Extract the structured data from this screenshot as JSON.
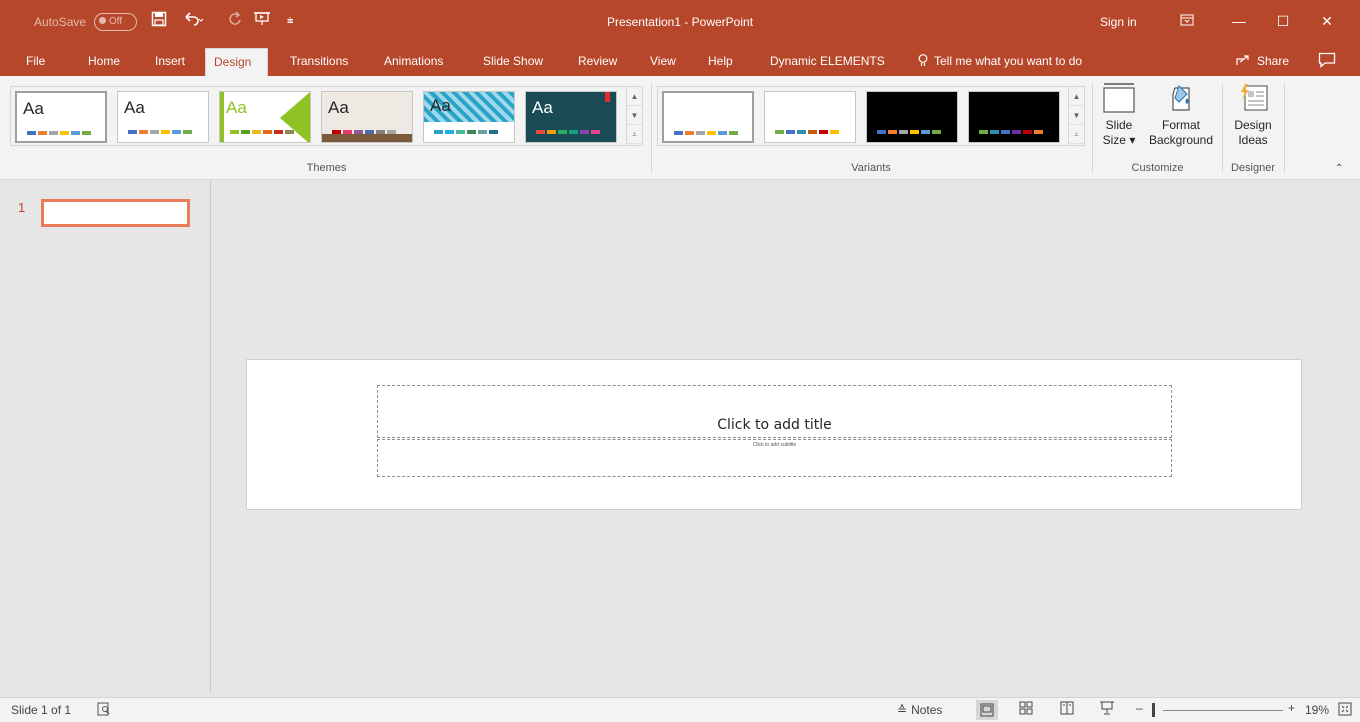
{
  "titlebar": {
    "autosave_label": "AutoSave",
    "autosave_state": "Off",
    "window_title": "Presentation1  -  PowerPoint",
    "sign_in": "Sign in"
  },
  "tabs": [
    "File",
    "Home",
    "Insert",
    "Design",
    "Transitions",
    "Animations",
    "Slide Show",
    "Review",
    "View",
    "Help",
    "Dynamic ELEMENTS"
  ],
  "active_tab": "Design",
  "tell_me": "Tell me what you want to do",
  "share": "Share",
  "ribbon": {
    "themes_label": "Themes",
    "variants_label": "Variants",
    "customize_label": "Customize",
    "designer_label": "Designer",
    "theme_sample": "Aa",
    "slide_size_line1": "Slide",
    "slide_size_line2": "Size ▾",
    "format_bg_line1": "Format",
    "format_bg_line2": "Background",
    "design_ideas_line1": "Design",
    "design_ideas_line2": "Ideas"
  },
  "thumbnails": {
    "slide_number": "1"
  },
  "slide": {
    "title_placeholder": "Click to add title",
    "subtitle_placeholder": "Click to add subtitle"
  },
  "status": {
    "slide_info": "Slide 1 of 1",
    "notes": "Notes",
    "zoom": "19%"
  },
  "colors": {
    "accent": "#b7472a",
    "ribbon_bg": "#f3f3f3",
    "workspace_bg": "#e6e6e6"
  }
}
